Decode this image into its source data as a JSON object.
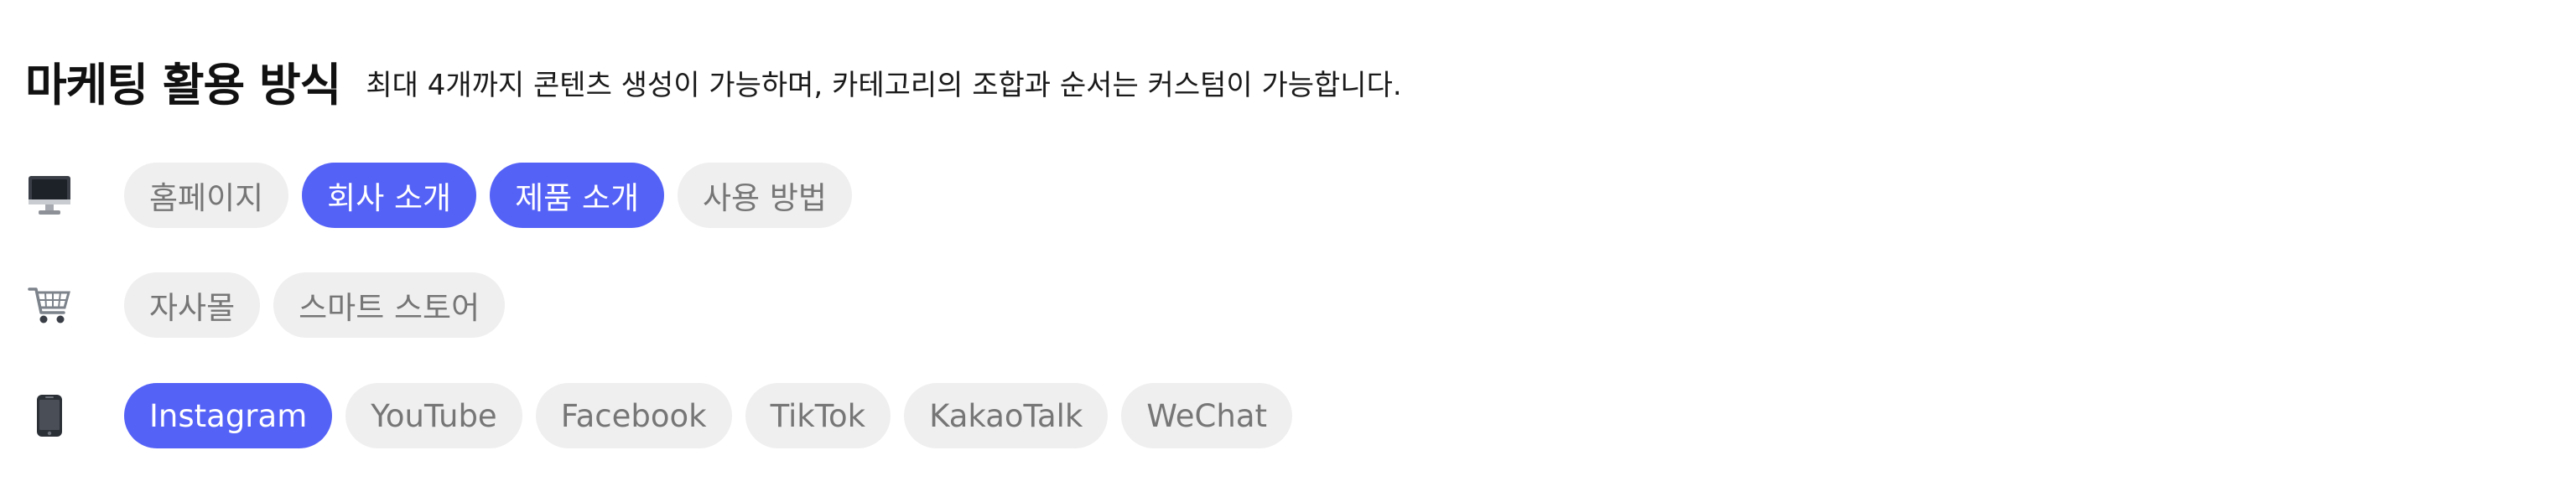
{
  "header": {
    "title": "마케팅 활용 방식",
    "subtitle": "최대 4개까지 콘텐츠 생성이 가능하며, 카테고리의 조합과 순서는 커스텀이 가능합니다."
  },
  "colors": {
    "selected_bg": "#5562f6",
    "chip_bg": "#efefef",
    "chip_text": "#767676"
  },
  "rows": [
    {
      "icon": "desktop-computer-icon",
      "chips": [
        {
          "label": "홈페이지",
          "selected": false
        },
        {
          "label": "회사 소개",
          "selected": true
        },
        {
          "label": "제품 소개",
          "selected": true
        },
        {
          "label": "사용 방법",
          "selected": false
        }
      ]
    },
    {
      "icon": "shopping-cart-icon",
      "chips": [
        {
          "label": "자사몰",
          "selected": false
        },
        {
          "label": "스마트 스토어",
          "selected": false
        }
      ]
    },
    {
      "icon": "mobile-phone-icon",
      "chips": [
        {
          "label": "Instagram",
          "selected": true
        },
        {
          "label": "YouTube",
          "selected": false
        },
        {
          "label": "Facebook",
          "selected": false
        },
        {
          "label": "TikTok",
          "selected": false
        },
        {
          "label": "KakaoTalk",
          "selected": false
        },
        {
          "label": "WeChat",
          "selected": false
        }
      ]
    }
  ]
}
